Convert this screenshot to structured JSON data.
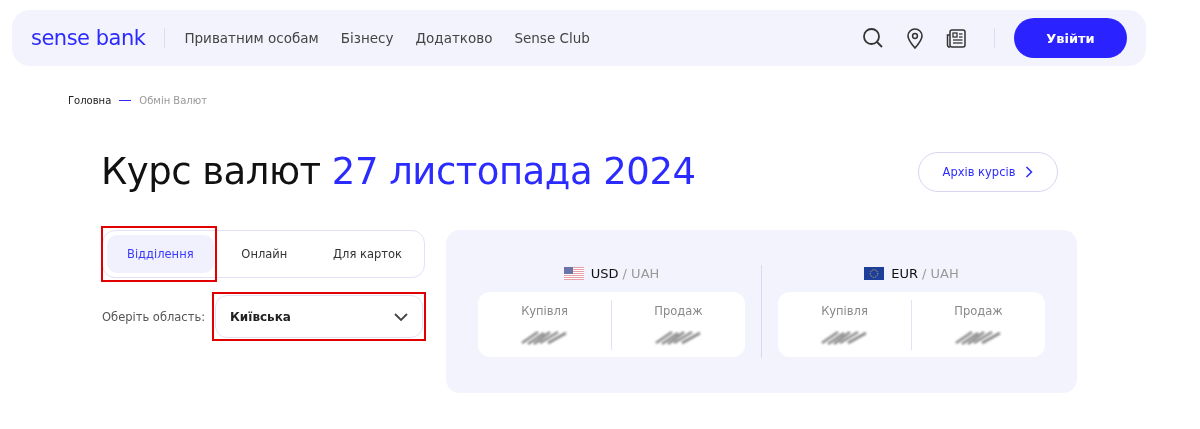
{
  "header": {
    "logo": "sense bank",
    "nav": [
      {
        "label": "Приватним особам"
      },
      {
        "label": "Бізнесу"
      },
      {
        "label": "Додатково"
      },
      {
        "label": "Sense Club"
      }
    ],
    "login_button": "Увійти"
  },
  "breadcrumb": [
    {
      "label": "Головна",
      "current": false
    },
    {
      "label": "Обмін Валют",
      "current": true
    }
  ],
  "heading": {
    "text": "Курс валют",
    "date": "27 листопада 2024"
  },
  "archive_button": "Архів курсів",
  "tabs": [
    {
      "label": "Відділення",
      "selected": true,
      "highlighted": true
    },
    {
      "label": "Онлайн",
      "selected": false,
      "highlighted": false
    },
    {
      "label": "Для карток",
      "selected": false,
      "highlighted": false
    }
  ],
  "region": {
    "label": "Оберіть область:",
    "value": "Київська",
    "highlighted": true
  },
  "rates": [
    {
      "currency": "USD",
      "base": "/ UAH",
      "kind": "us",
      "columns": [
        "Купівля",
        "Продаж"
      ]
    },
    {
      "currency": "EUR",
      "base": "/ UAH",
      "kind": "eu",
      "columns": [
        "Купівля",
        "Продаж"
      ]
    }
  ]
}
